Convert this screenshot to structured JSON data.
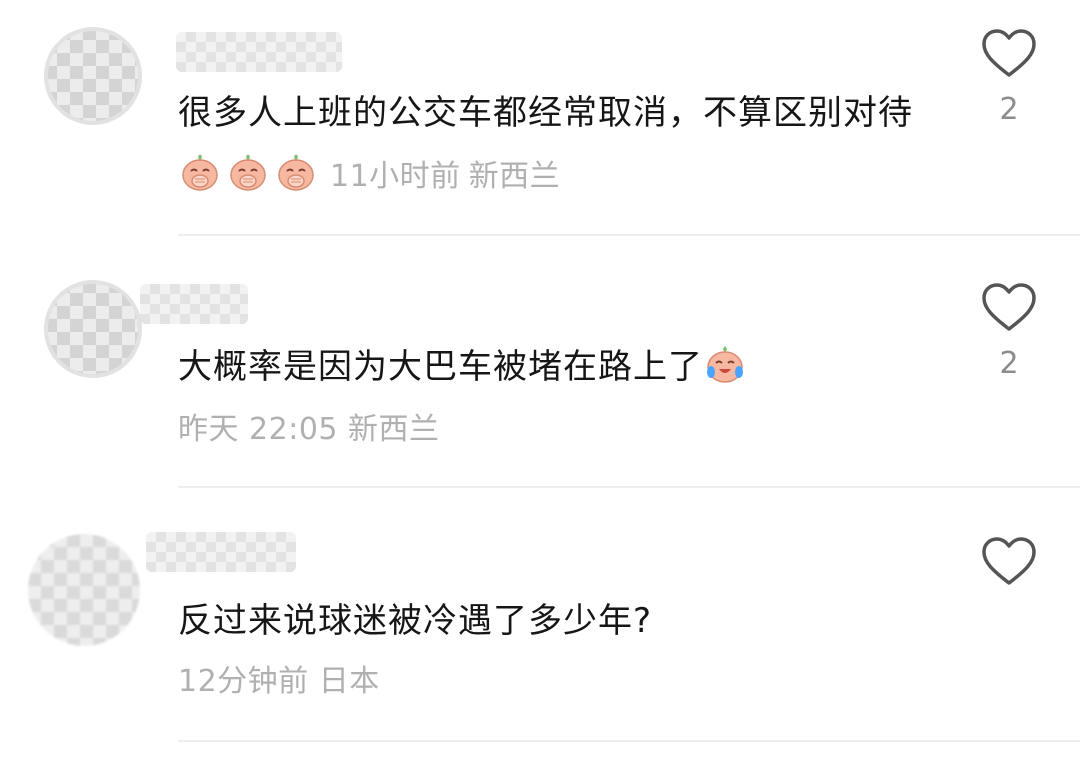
{
  "comments": [
    {
      "text": "很多人上班的公交车都经常取消，不算区别对待",
      "emojis": [
        "covering-mouth-laugh-emoji",
        "covering-mouth-laugh-emoji",
        "covering-mouth-laugh-emoji"
      ],
      "time": "11小时前",
      "location": "新西兰",
      "likes": "2"
    },
    {
      "text": "大概率是因为大巴车被堵在路上了",
      "emojis": [
        "crying-laughing-emoji"
      ],
      "time": "昨天 22:05",
      "location": "新西兰",
      "likes": "2"
    },
    {
      "text": "反过来说球迷被冷遇了多少年?",
      "emojis": [],
      "time": "12分钟前",
      "location": "日本",
      "likes": ""
    }
  ],
  "colors": {
    "text": "#161616",
    "meta": "#b0b0b0",
    "like_count": "#8c8c8c",
    "divider": "#eeeeee",
    "emoji_face": "#f6b8a0",
    "emoji_leaf": "#7cc36b"
  }
}
